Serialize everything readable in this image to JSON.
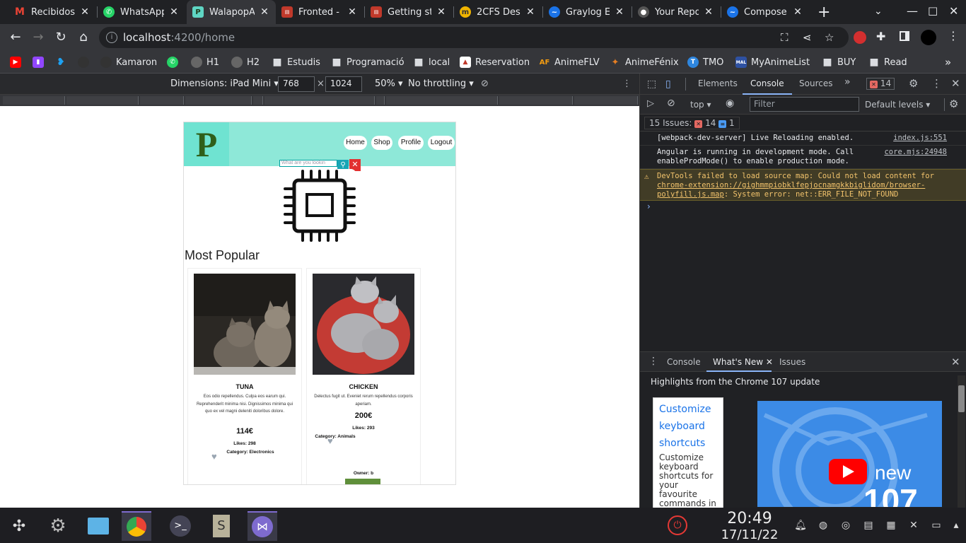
{
  "browser": {
    "tabs": [
      {
        "label": "Recibidos (",
        "favicon": "gmail-icon",
        "color": "#ea4335"
      },
      {
        "label": "WhatsApp",
        "favicon": "whatsapp-icon",
        "color": "#25d366"
      },
      {
        "label": "WalapopA",
        "favicon": "walapop-icon",
        "color": "#5fd6c4",
        "active": true
      },
      {
        "label": "Fronted - ",
        "favicon": "doc-icon",
        "color": "#c0392b"
      },
      {
        "label": "Getting st",
        "favicon": "doc-icon",
        "color": "#c0392b"
      },
      {
        "label": "2CFS Desp",
        "favicon": "moodle-icon",
        "color": "#f0b400"
      },
      {
        "label": "Graylog E",
        "favicon": "graylog-icon",
        "color": "#1a73e8"
      },
      {
        "label": "Your Repo",
        "favicon": "github-icon",
        "color": "#555555"
      },
      {
        "label": "Compose",
        "favicon": "docker-icon",
        "color": "#1a73e8"
      }
    ],
    "url_host": "localhost",
    "url_path": ":4200/home",
    "bookmarks": [
      {
        "label": "",
        "icon": "youtube-icon",
        "color": "#ff0000"
      },
      {
        "label": "",
        "icon": "twitch-icon",
        "color": "#9146ff"
      },
      {
        "label": "",
        "icon": "twitter-icon",
        "color": "#1da1f2"
      },
      {
        "label": "",
        "icon": "github-icon",
        "color": "#333333"
      },
      {
        "label": "Kamaron",
        "icon": "globe-icon",
        "color": "#444444"
      },
      {
        "label": "",
        "icon": "whatsapp-icon",
        "color": "#25d366"
      },
      {
        "label": "H1",
        "icon": "globe-icon",
        "color": "#666666"
      },
      {
        "label": "H2",
        "icon": "globe-icon",
        "color": "#666666"
      },
      {
        "label": "Estudis",
        "icon": "folder-icon",
        "color": "#dadce0"
      },
      {
        "label": "Programació",
        "icon": "folder-icon",
        "color": "#dadce0"
      },
      {
        "label": "local",
        "icon": "folder-icon",
        "color": "#dadce0"
      },
      {
        "label": "Reservation",
        "icon": "reservation-icon",
        "color": "#c0392b"
      },
      {
        "label": "AnimeFLV",
        "icon": "animeflv-icon",
        "color": "#f39c12"
      },
      {
        "label": "AnimeFénix",
        "icon": "animefenix-icon",
        "color": "#e67e22"
      },
      {
        "label": "TMO",
        "icon": "tmo-icon",
        "color": "#2e86de"
      },
      {
        "label": "MyAnimeList",
        "icon": "mal-icon",
        "color": "#2e51a2"
      },
      {
        "label": "BUY",
        "icon": "folder-icon",
        "color": "#dadce0"
      },
      {
        "label": "Read",
        "icon": "folder-icon",
        "color": "#dadce0"
      }
    ]
  },
  "device_toolbar": {
    "dimensions_label": "Dimensions: iPad Mini",
    "width": "768",
    "height": "1024",
    "zoom": "50%",
    "throttling": "No throttling"
  },
  "app": {
    "logo": "P",
    "nav": [
      "Home",
      "Shop",
      "Profile",
      "Logout"
    ],
    "search_placeholder": "What are you lookin",
    "section_title": "Most Popular",
    "products": [
      {
        "name": "TUNA",
        "description": "Eos odio repellendus. Culpa eos earum qui. Reprehenderit minima nisi. Dignissimos minima qui quo ex vel magni deleniti doloribus dolore.",
        "price": "114€",
        "likes": "Likes: 298",
        "category": "Category: Electronics",
        "owner": ""
      },
      {
        "name": "CHICKEN",
        "description": "Delectus fugit ut. Eveniet rerum repellendus corporis aperiam.",
        "price": "200€",
        "likes": "Likes: 293",
        "category": "Category: Animals",
        "owner": "Owner: b"
      }
    ]
  },
  "devtools": {
    "tabs": [
      "Elements",
      "Console",
      "Sources"
    ],
    "error_count": "14",
    "context": "top",
    "filter_placeholder": "Filter",
    "levels": "Default levels",
    "issues_label": "15 Issues:",
    "issues_errors": "14",
    "issues_info": "1",
    "logs": [
      {
        "msg": "[webpack-dev-server] Live Reloading enabled.",
        "src": "index.js:551"
      },
      {
        "msg": "Angular is running in development mode. Call enableProdMode() to enable production mode.",
        "src": "core.mjs:24948"
      }
    ],
    "warning_prefix": "DevTools failed to load source map: Could not load content for ",
    "warning_link": "chrome-extension://gighmmpiobklfepjocnamgkkbiglidom/browser-polyfill.js.map",
    "warning_suffix": ": System error: net::ERR_FILE_NOT_FOUND",
    "drawer_tabs": [
      "Console",
      "What's New",
      "Issues"
    ],
    "highlights": "Highlights from the Chrome 107 update",
    "shortcut_title": "Customize keyboard shortcuts",
    "shortcut_desc": "Customize keyboard shortcuts for your favourite commands in DevTools.",
    "promo_text": "new",
    "promo_number": "107"
  },
  "taskbar": {
    "time": "20:49",
    "date": "17/11/22"
  }
}
